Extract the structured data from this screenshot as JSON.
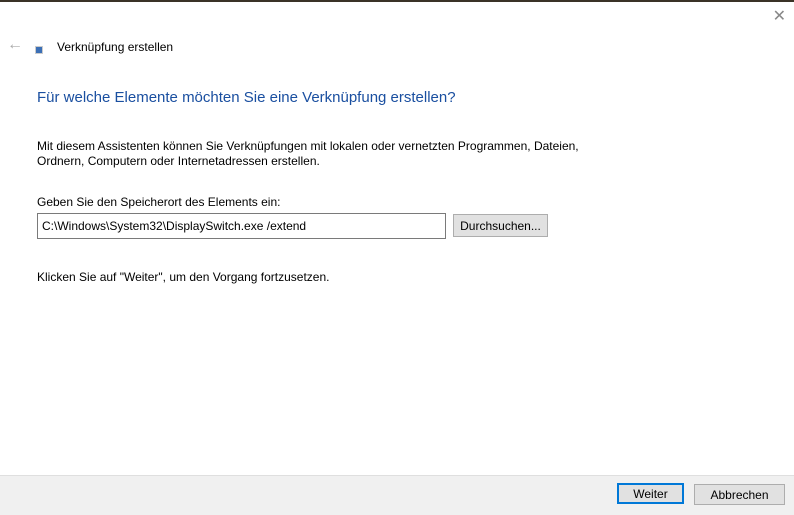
{
  "window": {
    "title": "Verknüpfung erstellen"
  },
  "heading": "Für welche Elemente möchten Sie eine Verknüpfung erstellen?",
  "description": "Mit diesem Assistenten können Sie Verknüpfungen mit lokalen oder vernetzten Programmen, Dateien, Ordnern, Computern oder Internetadressen erstellen.",
  "location": {
    "label": "Geben Sie den Speicherort des Elements ein:",
    "value": "C:\\Windows\\System32\\DisplaySwitch.exe /extend",
    "browse_label": "Durchsuchen..."
  },
  "hint": "Klicken Sie auf \"Weiter\", um den Vorgang fortzusetzen.",
  "footer": {
    "next_label": "Weiter",
    "cancel_label": "Abbrechen"
  }
}
